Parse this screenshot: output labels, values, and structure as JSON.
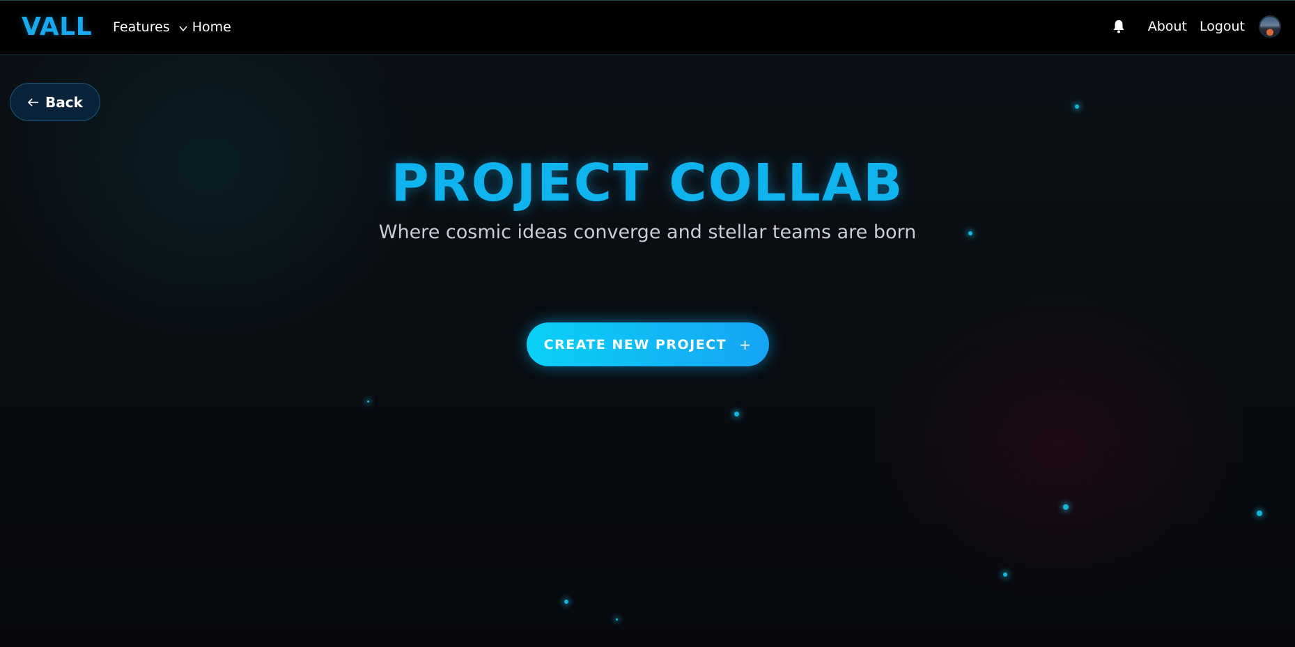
{
  "brand": {
    "logo_text": "VALL"
  },
  "nav": {
    "features_label": "Features",
    "home_label": "Home",
    "about_label": "About",
    "logout_label": "Logout"
  },
  "back_button": {
    "label": "Back"
  },
  "hero": {
    "title": "PROJECT COLLAB",
    "subtitle": "Where cosmic ideas converge and stellar teams are born",
    "cta_label": "CREATE NEW PROJECT",
    "cta_icon": "+"
  },
  "icons": {
    "features_chevron": "chevron-down-icon",
    "notifications": "bell-icon",
    "back_arrow": "arrow-left-icon",
    "cta_plus": "plus-icon"
  },
  "colors": {
    "accent": "#0fb4ee",
    "logo": "#19a9ee",
    "background": "#07090d",
    "navbar": "#000000",
    "back_button_bg": "#08233a",
    "cta_gradient_start": "#0ad0f6",
    "cta_gradient_end": "#16a4f4"
  }
}
